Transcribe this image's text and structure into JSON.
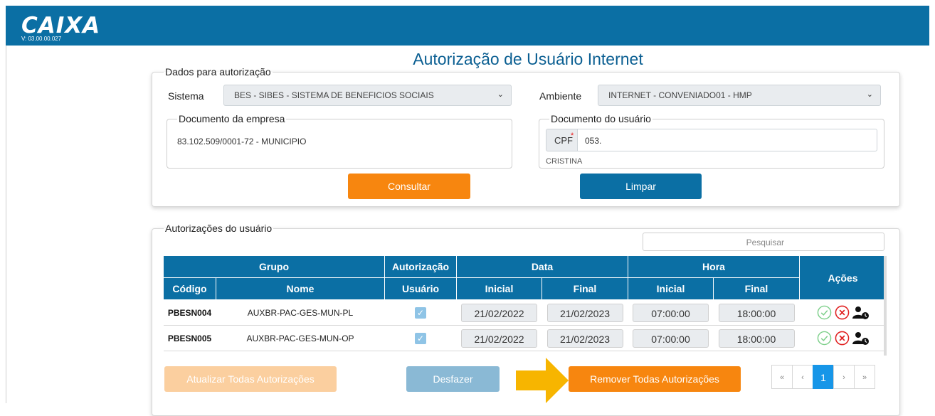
{
  "header": {
    "logo": "CAIXA",
    "version": "V: 03.00.00.027"
  },
  "page_title": "Autorização de Usuário Internet",
  "auth_panel": {
    "legend": "Dados para autorização",
    "sistema_label": "Sistema",
    "sistema_value": "BES - SIBES - SISTEMA DE BENEFICIOS SOCIAIS",
    "ambiente_label": "Ambiente",
    "ambiente_value": "INTERNET - CONVENIADO01 - HMP",
    "empresa_legend": "Documento da empresa",
    "empresa_value": "83.102.509/0001-72 - MUNICIPIO",
    "usuario_legend": "Documento do usuário",
    "cpf_label": "CPF",
    "cpf_required": "*",
    "cpf_value": "053.",
    "usuario_name": "CRISTINA",
    "consultar_label": "Consultar",
    "limpar_label": "Limpar"
  },
  "authorizations": {
    "legend": "Autorizações do usuário",
    "search_placeholder": "Pesquisar",
    "header_top": {
      "grupo": "Grupo",
      "autorizacao": "Autorização",
      "data": "Data",
      "hora": "Hora",
      "acoes": "Ações"
    },
    "header_sub": {
      "codigo": "Código",
      "nome": "Nome",
      "usuario": "Usuário",
      "data_inicial": "Inicial",
      "data_final": "Final",
      "hora_inicial": "Inicial",
      "hora_final": "Final"
    },
    "rows": [
      {
        "codigo": "PBESN004",
        "nome": "AUXBR-PAC-GES-MUN-PL",
        "usuario_checked": true,
        "data_inicial": "21/02/2022",
        "data_final": "21/02/2023",
        "hora_inicial": "07:00:00",
        "hora_final": "18:00:00"
      },
      {
        "codigo": "PBESN005",
        "nome": "AUXBR-PAC-GES-MUN-OP",
        "usuario_checked": true,
        "data_inicial": "21/02/2022",
        "data_final": "21/02/2023",
        "hora_inicial": "07:00:00",
        "hora_final": "18:00:00"
      }
    ],
    "atualizar_label": "Atualizar Todas Autorizações",
    "desfazer_label": "Desfazer",
    "remover_label": "Remover Todas Autorizações",
    "pagination": {
      "first": "«",
      "prev": "‹",
      "current": "1",
      "next": "›",
      "last": "»"
    }
  },
  "colors": {
    "brand_blue": "#0b6fa4",
    "orange": "#f7860f",
    "approve_green": "#7dcf8a",
    "reject_red": "#e02020",
    "arrow_yellow": "#f7b500"
  }
}
